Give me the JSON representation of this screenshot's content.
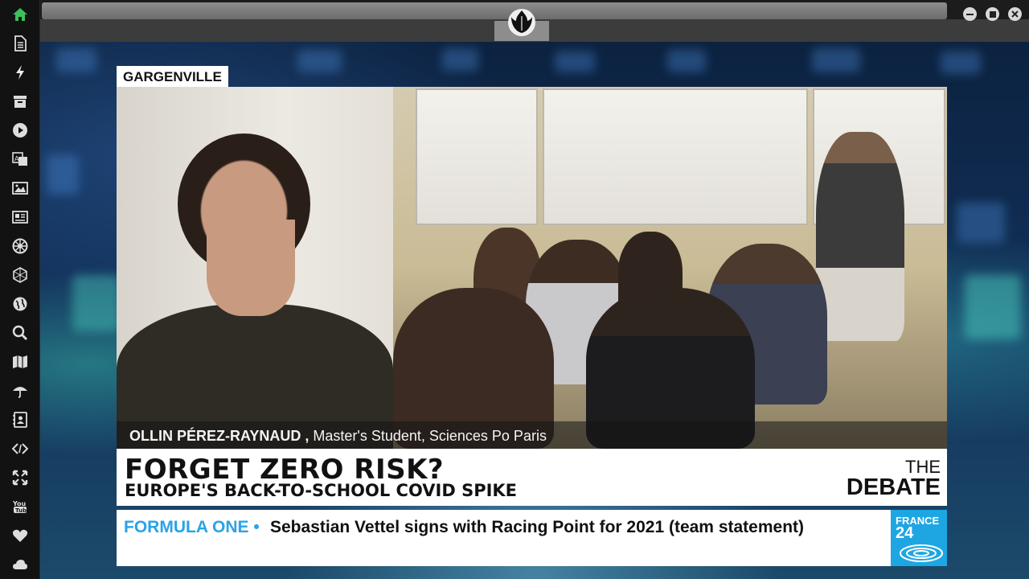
{
  "sidebar": {
    "items": [
      {
        "icon": "home-icon",
        "color": "#3fbf5a"
      },
      {
        "icon": "document-icon"
      },
      {
        "icon": "lightning-icon"
      },
      {
        "icon": "archive-icon"
      },
      {
        "icon": "play-icon"
      },
      {
        "icon": "translate-icon"
      },
      {
        "icon": "image-icon"
      },
      {
        "icon": "newspaper-icon"
      },
      {
        "icon": "galactic-empire-icon"
      },
      {
        "icon": "hexagon-icon"
      },
      {
        "icon": "globe-icon"
      },
      {
        "icon": "search-icon"
      },
      {
        "icon": "map-icon"
      },
      {
        "icon": "umbrella-icon"
      },
      {
        "icon": "contact-book-icon"
      },
      {
        "icon": "code-icon"
      },
      {
        "icon": "expand-icon"
      },
      {
        "icon": "youtube-icon"
      },
      {
        "icon": "heart-icon"
      },
      {
        "icon": "cloud-icon"
      }
    ]
  },
  "window": {
    "logo": "rebel-alliance-icon",
    "controls": [
      "minimize-icon",
      "maximize-icon",
      "close-icon"
    ]
  },
  "broadcast": {
    "location": "GARGENVILLE",
    "speaker_name": "OLLIN PÉREZ-RAYNAUD",
    "speaker_separator": " , ",
    "speaker_title": "Master's Student, Sciences Po Paris",
    "headline_main": "FORGET ZERO RISK?",
    "headline_sub": "EUROPE'S BACK-TO-SCHOOL COVID SPIKE",
    "program_line1": "THE",
    "program_line2": "DEBATE",
    "ticker_category": "FORMULA ONE •",
    "ticker_text": "Sebastian Vettel signs with Racing Point for 2021 (team statement)",
    "channel_line1": "FRANCE",
    "channel_line2": "24",
    "accent_color": "#1ea6e3"
  }
}
